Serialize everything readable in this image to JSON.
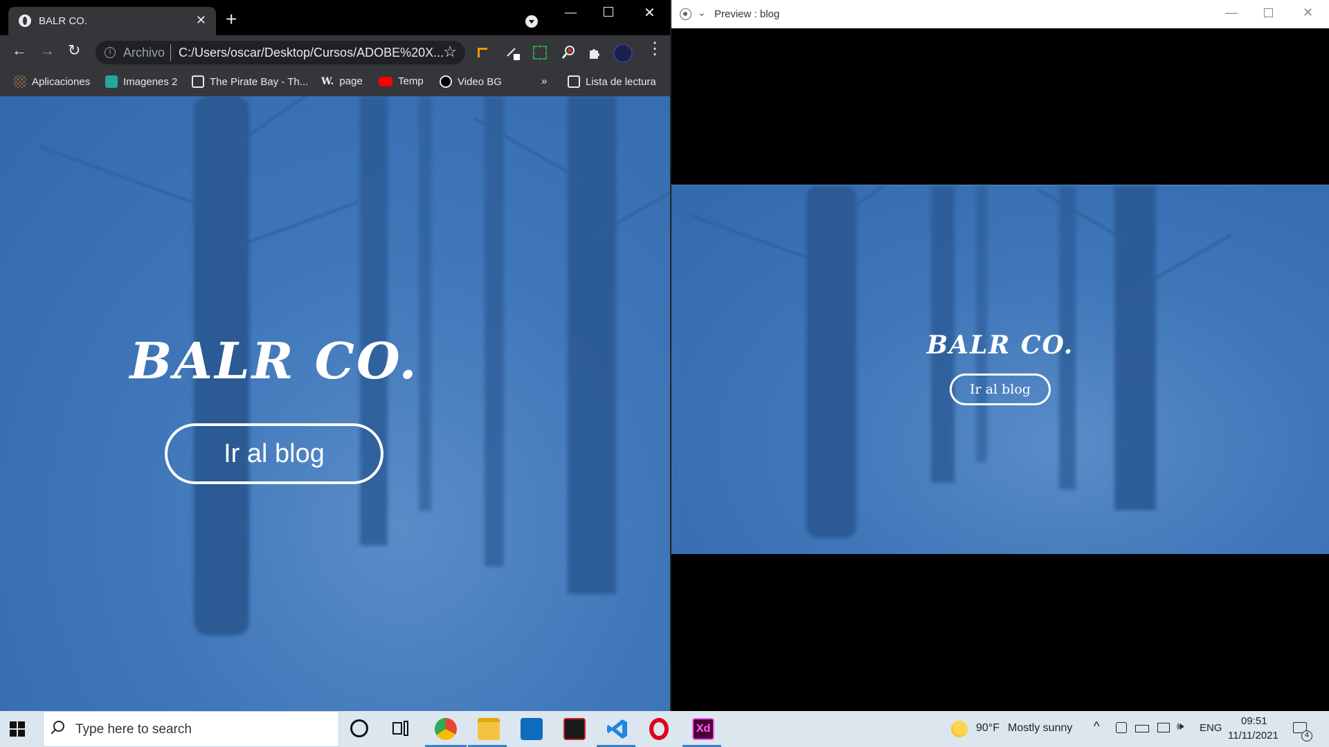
{
  "browser": {
    "tab_title": "BALR CO.",
    "url_scheme": "Archivo",
    "url": "C:/Users/oscar/Desktop/Cursos/ADOBE%20X...",
    "bookmarks": [
      {
        "label": "Aplicaciones",
        "icon": "apps-grid-icon"
      },
      {
        "label": "Imagenes 2",
        "icon": "image-bookmark-icon"
      },
      {
        "label": "The Pirate Bay - Th...",
        "icon": "ship-bookmark-icon"
      },
      {
        "label": "page",
        "icon": "w-bookmark-icon"
      },
      {
        "label": "Temp",
        "icon": "youtube-icon"
      },
      {
        "label": "Video BG",
        "icon": "c-bookmark-icon"
      }
    ],
    "bookmarks_overflow": "»",
    "reading_list": "Lista de lectura"
  },
  "site": {
    "brand": "BALR CO.",
    "cta_label": "Ir al blog"
  },
  "preview": {
    "window_title": "Preview : blog",
    "brand": "BALR CO.",
    "cta_label": "Ir al blog"
  },
  "taskbar": {
    "search_placeholder": "Type here to search",
    "weather_temp": "90°F",
    "weather_desc": "Mostly sunny",
    "language": "ENG",
    "time": "09:51",
    "date": "11/11/2021",
    "notification_count": "4"
  },
  "colors": {
    "overlay_blue": "#3a72b5",
    "chrome_dark": "#35363a",
    "taskbar": "#dce6ef"
  }
}
